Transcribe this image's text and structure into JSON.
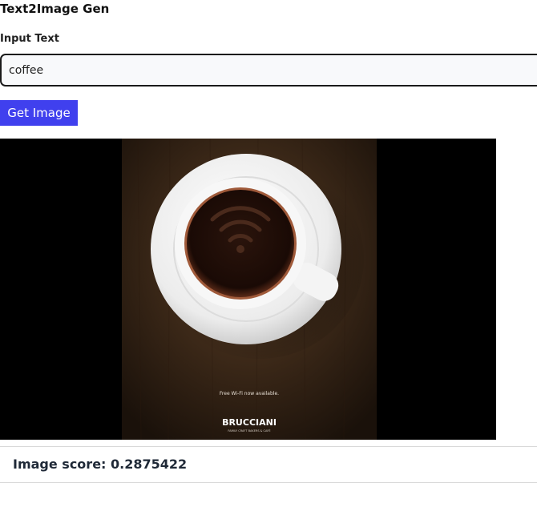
{
  "app": {
    "title": "Text2Image Gen"
  },
  "form": {
    "input_label": "Input Text",
    "input_value": "coffee",
    "submit_label": "Get Image"
  },
  "result": {
    "poster_caption": "Free Wi-Fi now available.",
    "poster_brand": "BRUCCIANI",
    "poster_tagline": "FAMILY CRAFT BAKERS & CAFÉ",
    "score_label": "Image score:",
    "score_value": "0.2875422"
  }
}
